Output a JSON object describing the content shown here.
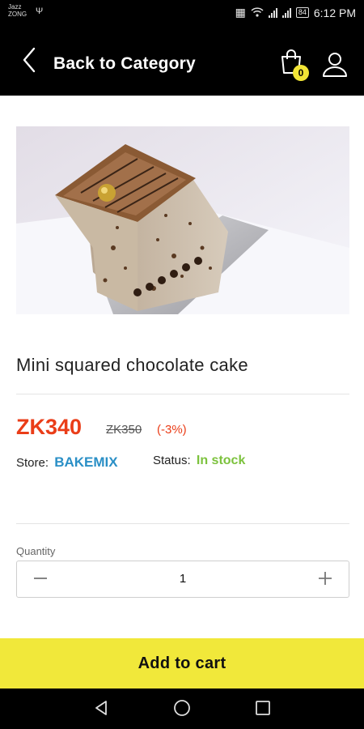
{
  "status_bar": {
    "carrier_line1": "Jazz",
    "carrier_line2": "ZONG",
    "battery": "84",
    "time": "6:12 PM"
  },
  "header": {
    "title": "Back to Category",
    "cart_count": "0",
    "icons": {
      "back": "chevron-left-icon",
      "cart": "shopping-bag-icon",
      "user": "user-icon"
    }
  },
  "product": {
    "name": "Mini squared chocolate cake",
    "price": "ZK340",
    "old_price": "ZK350",
    "discount": "(-3%)",
    "store_label": "Store:",
    "store_name": "BAKEMIX",
    "status_label": "Status:",
    "status_value": "In stock"
  },
  "quantity": {
    "label": "Quantity",
    "value": "1"
  },
  "actions": {
    "add_to_cart": "Add to cart"
  },
  "colors": {
    "price": "#ea3d18",
    "store": "#2a8fc6",
    "in_stock": "#7cc23d",
    "accent_yellow": "#f1e83a"
  }
}
